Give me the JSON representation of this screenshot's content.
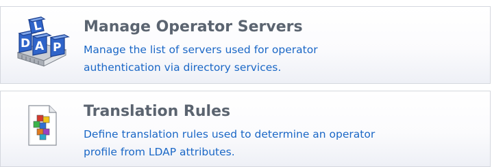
{
  "items": [
    {
      "title": "Manage Operator Servers",
      "description_lines": [
        "Manage the list of servers used for operator",
        "authentication via directory services."
      ],
      "icon": "ldap-directory-icon"
    },
    {
      "title": "Translation Rules",
      "description_lines": [
        "Define translation rules used to determine an operator",
        "profile from LDAP attributes."
      ],
      "icon": "translation-rules-document-icon"
    }
  ],
  "colors": {
    "title": "#5b6470",
    "description": "#1a67c6",
    "border": "#d4d7de"
  },
  "ldap_icon_text": "LDAP"
}
